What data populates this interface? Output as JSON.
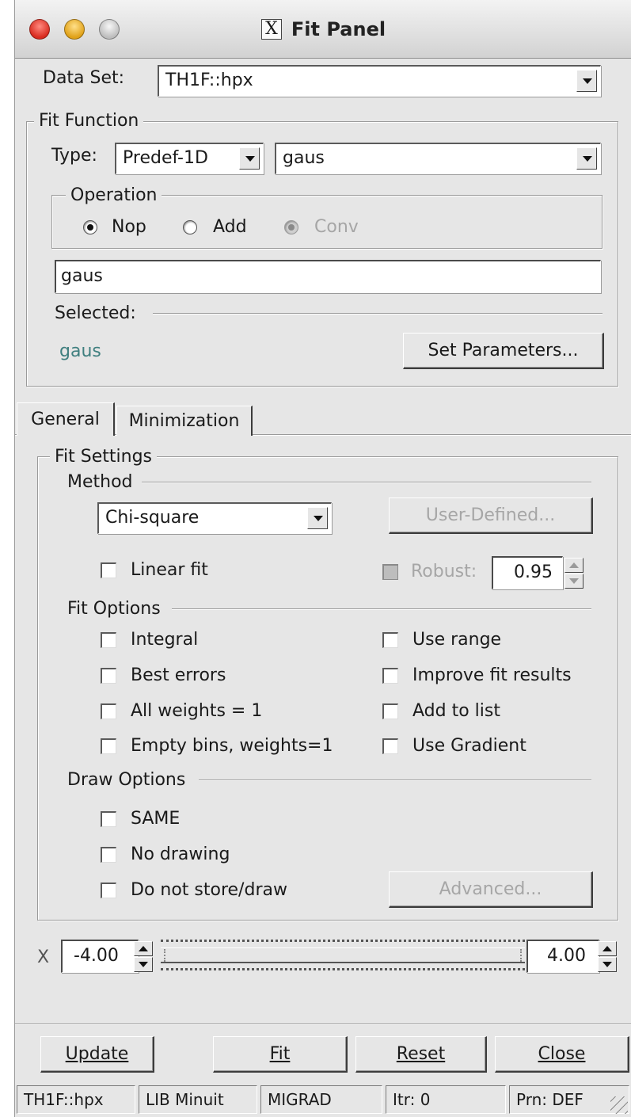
{
  "window": {
    "title": "Fit Panel",
    "title_icon": "X"
  },
  "dataset": {
    "label": "Data Set:",
    "value": "TH1F::hpx"
  },
  "fit_function": {
    "group_label": "Fit Function",
    "type_label": "Type:",
    "type_value": "Predef-1D",
    "function_value": "gaus",
    "operation": {
      "group_label": "Operation",
      "options": [
        {
          "label": "Nop",
          "selected": true,
          "enabled": true
        },
        {
          "label": "Add",
          "selected": false,
          "enabled": true
        },
        {
          "label": "Conv",
          "selected": false,
          "enabled": false
        }
      ]
    },
    "formula_value": "gaus",
    "selected_label": "Selected:",
    "selected_value": "gaus",
    "selected_color": "#3f7f7f",
    "set_parameters_label": "Set Parameters..."
  },
  "tabs": [
    {
      "label": "General",
      "active": true
    },
    {
      "label": "Minimization",
      "active": false
    }
  ],
  "fit_settings": {
    "group_label": "Fit Settings",
    "method": {
      "section_label": "Method",
      "value": "Chi-square",
      "user_defined_label": "User-Defined...",
      "linear_fit_label": "Linear fit",
      "robust_label": "Robust:",
      "robust_value": "0.95"
    },
    "fit_options": {
      "section_label": "Fit Options",
      "left": [
        "Integral",
        "Best errors",
        "All weights = 1",
        "Empty bins, weights=1"
      ],
      "right": [
        "Use range",
        "Improve fit results",
        "Add to list",
        "Use Gradient"
      ]
    },
    "draw_options": {
      "section_label": "Draw Options",
      "items": [
        "SAME",
        "No drawing",
        "Do not store/draw"
      ],
      "advanced_label": "Advanced..."
    }
  },
  "range": {
    "axis_label": "X",
    "min": "-4.00",
    "max": "4.00"
  },
  "buttons": {
    "update": "Update",
    "fit": "Fit",
    "reset": "Reset",
    "close": "Close"
  },
  "status": [
    "TH1F::hpx",
    "LIB Minuit",
    "MIGRAD",
    "Itr: 0",
    "Prn: DEF"
  ]
}
